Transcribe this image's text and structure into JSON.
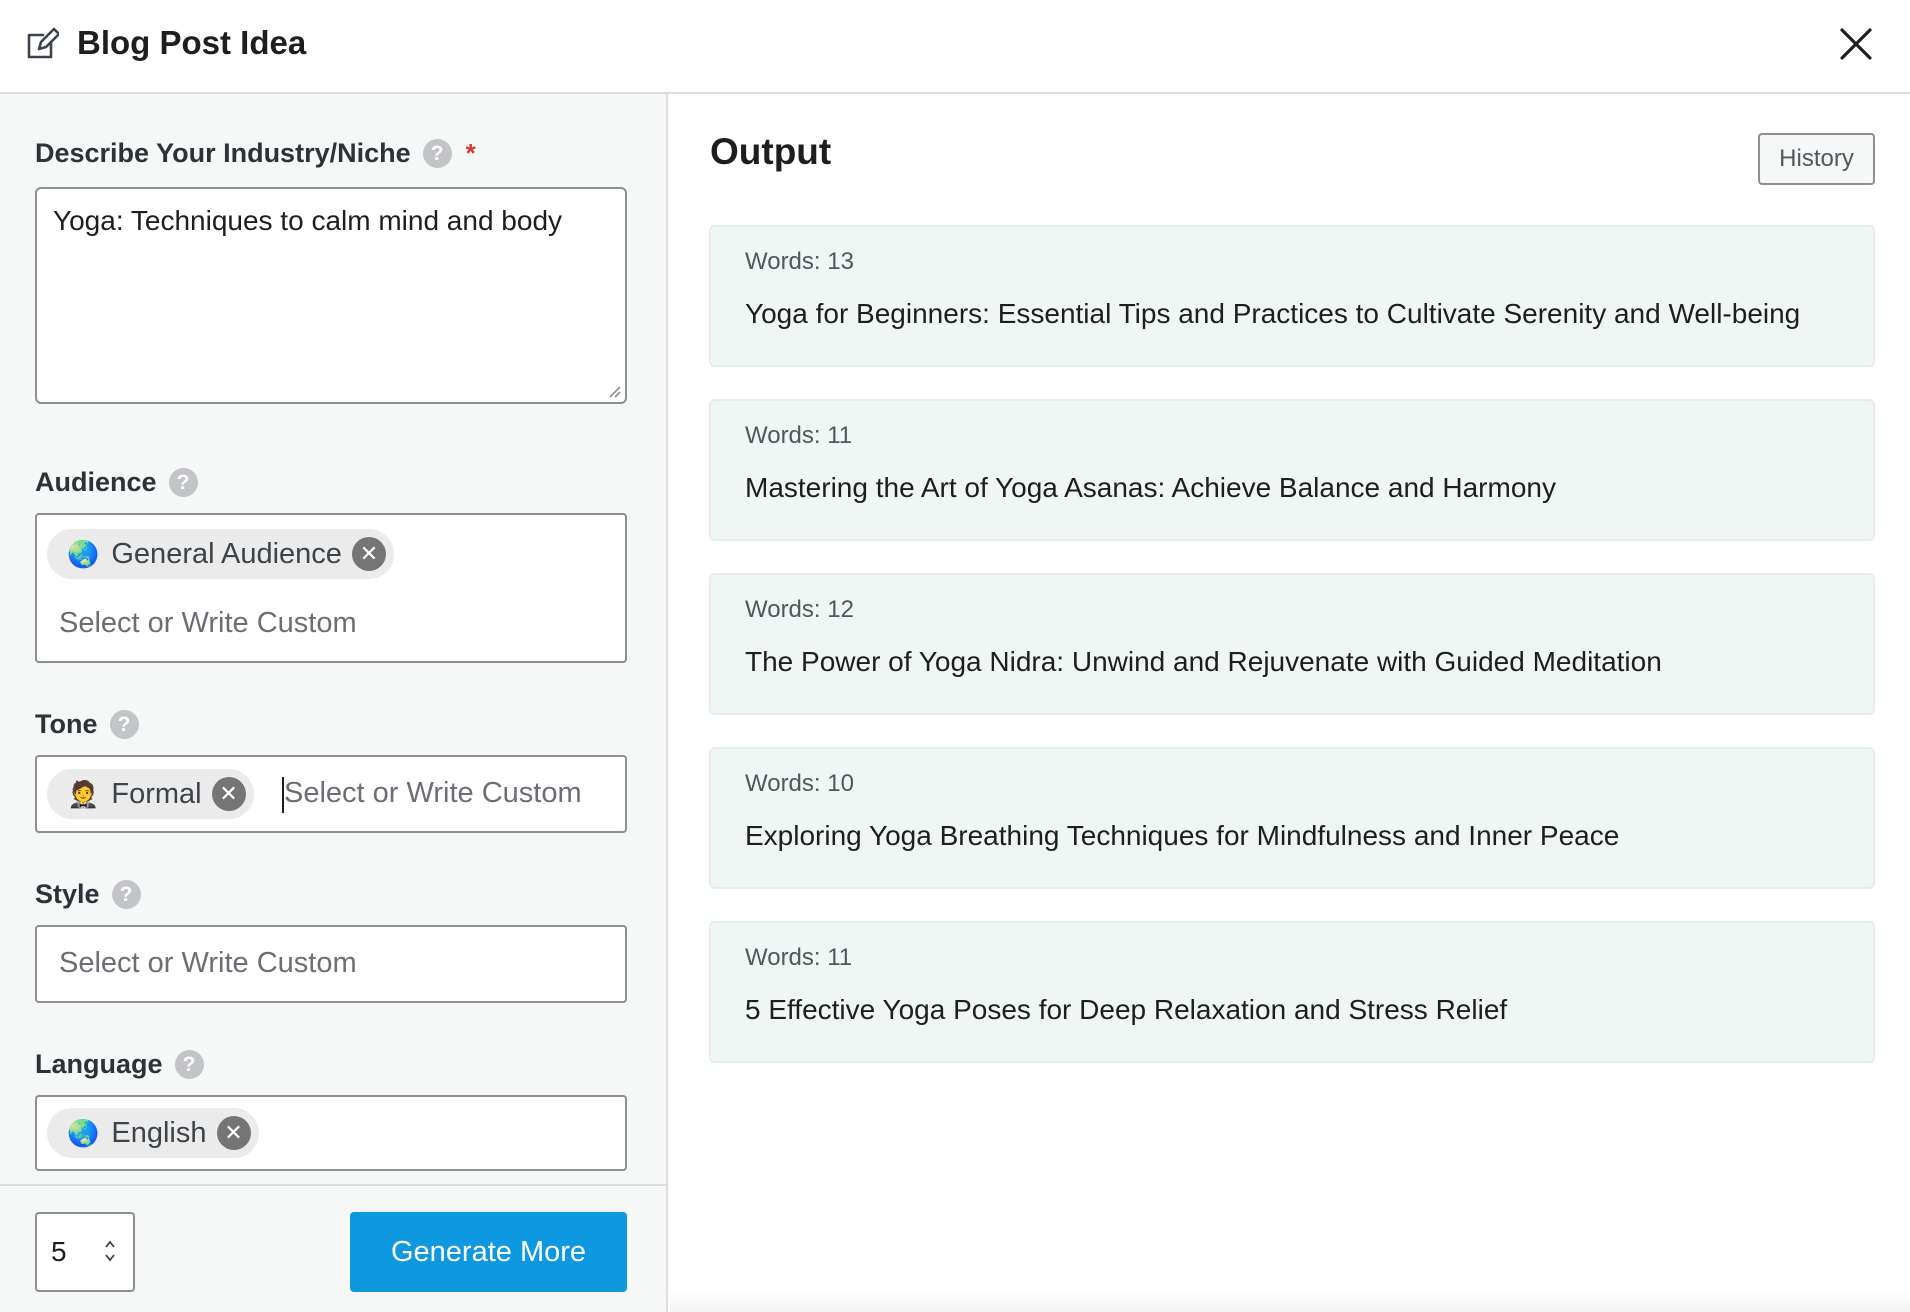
{
  "header": {
    "icon": "edit-icon",
    "title": "Blog Post Idea",
    "close_icon": "close-icon"
  },
  "form": {
    "niche": {
      "label": "Describe Your Industry/Niche",
      "required_mark": "*",
      "value": "Yoga: Techniques to calm mind and body"
    },
    "audience": {
      "label": "Audience",
      "chips": [
        {
          "emoji": "🌏",
          "label": "General Audience"
        }
      ],
      "placeholder": "Select or Write Custom"
    },
    "tone": {
      "label": "Tone",
      "chips": [
        {
          "emoji": "🤵",
          "label": "Formal"
        }
      ],
      "placeholder": "Select or Write Custom"
    },
    "style": {
      "label": "Style",
      "placeholder": "Select or Write Custom"
    },
    "language": {
      "label": "Language",
      "chips": [
        {
          "emoji": "🌏",
          "label": "English"
        }
      ]
    },
    "count": "5",
    "generate_label": "Generate More",
    "help_glyph": "?",
    "remove_glyph": "✕"
  },
  "output": {
    "title": "Output",
    "history_label": "History",
    "ideas": [
      {
        "words": "Words: 13",
        "text": "Yoga for Beginners: Essential Tips and Practices to Cultivate Serenity and Well-being"
      },
      {
        "words": "Words: 11",
        "text": "Mastering the Art of Yoga Asanas: Achieve Balance and Harmony"
      },
      {
        "words": "Words: 12",
        "text": "The Power of Yoga Nidra: Unwind and Rejuvenate with Guided Meditation"
      },
      {
        "words": "Words: 10",
        "text": "Exploring Yoga Breathing Techniques for Mindfulness and Inner Peace"
      },
      {
        "words": "Words: 11",
        "text": "5 Effective Yoga Poses for Deep Relaxation and Stress Relief"
      }
    ]
  },
  "colors": {
    "accent": "#0d98df",
    "card_bg": "#f0f6f3",
    "panel_bg": "#f6f7f7",
    "required": "#d63638"
  }
}
